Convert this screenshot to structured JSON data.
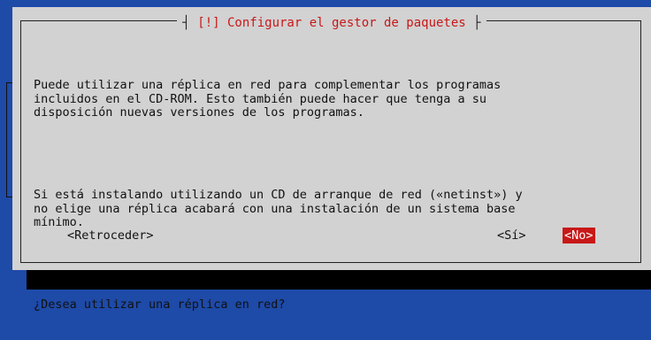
{
  "dialog": {
    "title_prefix": "[!]",
    "title": "Configurar el gestor de paquetes",
    "paragraphs": [
      "Puede utilizar una réplica en red para complementar los programas\nincluidos en el CD-ROM. Esto también puede hacer que tenga a su\ndisposición nuevas versiones de los programas.",
      "Si está instalando utilizando un CD de arranque de red («netinst») y\nno elige una réplica acabará con una instalación de un sistema base\nmínimo.",
      "¿Desea utilizar una réplica en red?"
    ],
    "buttons": {
      "back": "<Retroceder>",
      "yes": "<Sí>",
      "no": "<No>"
    }
  },
  "colors": {
    "background": "#1e4aa8",
    "dialog": "#d2d2d2",
    "accent": "#c81818"
  }
}
